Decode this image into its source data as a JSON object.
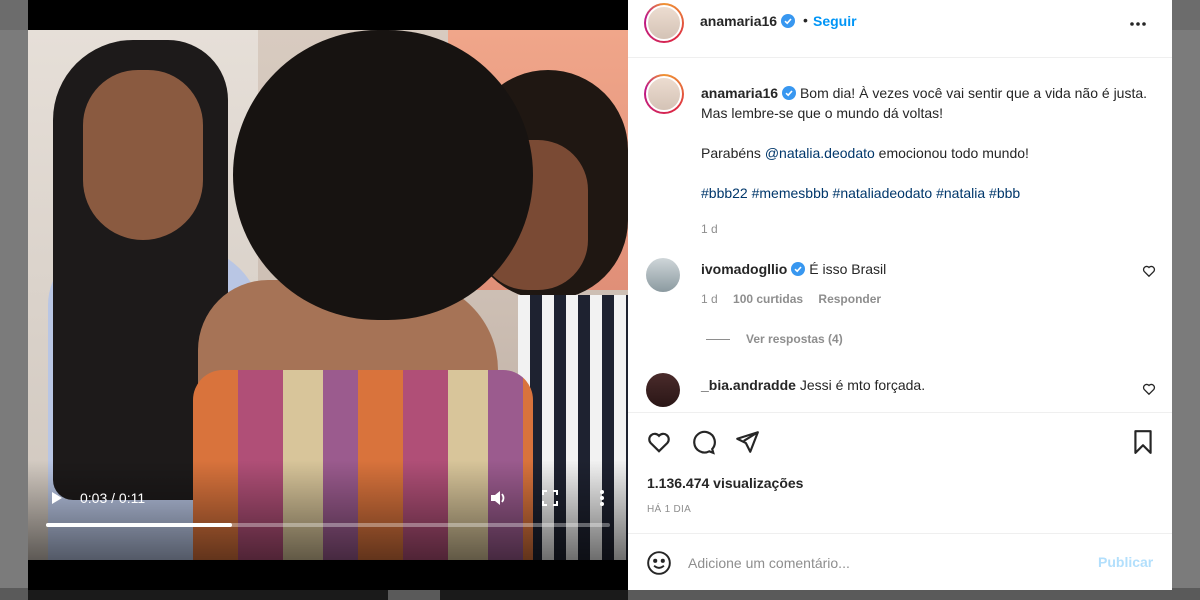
{
  "video": {
    "time": "0:03 / 0:11",
    "progress": 0.33
  },
  "post": {
    "author": "anamaria16",
    "follow_label": "Seguir",
    "follow_separator": "•",
    "caption_line1": "Bom dia! À vezes você vai sentir que a vida não é justa. Mas lembre-se que o mundo dá voltas!",
    "caption_para2_prefix": "Parabéns ",
    "caption_mention": "@natalia.deodato",
    "caption_para2_suffix": " emocionou todo mundo!",
    "hashtags": [
      "#bbb22",
      "#memesbbb",
      "#nataliadeodato",
      "#natalia",
      "#bbb"
    ],
    "caption_time": "1 d",
    "views": "1.136.474 visualizações",
    "time_ago": "HÁ 1 DIA"
  },
  "comments": [
    {
      "user": "ivomadogllio",
      "text": "É isso Brasil",
      "time": "1 d",
      "likes": "100 curtidas",
      "reply_label": "Responder",
      "view_replies": "Ver respostas (4)"
    },
    {
      "user": "_bia.andradde",
      "text": "Jessi é mto forçada."
    }
  ],
  "composer": {
    "placeholder": "Adicione um comentário...",
    "publish_label": "Publicar"
  },
  "colors": {
    "accent": "#0095f6",
    "link": "#00376b",
    "muted": "#8e8e8e",
    "publish_disabled": "#b2dffc"
  },
  "icons": [
    "play-icon",
    "volume-icon",
    "fullscreen-icon",
    "more-vertical-icon",
    "verified-icon",
    "more-horizontal-icon",
    "heart-icon",
    "comment-icon",
    "share-icon",
    "bookmark-icon",
    "emoji-icon"
  ]
}
